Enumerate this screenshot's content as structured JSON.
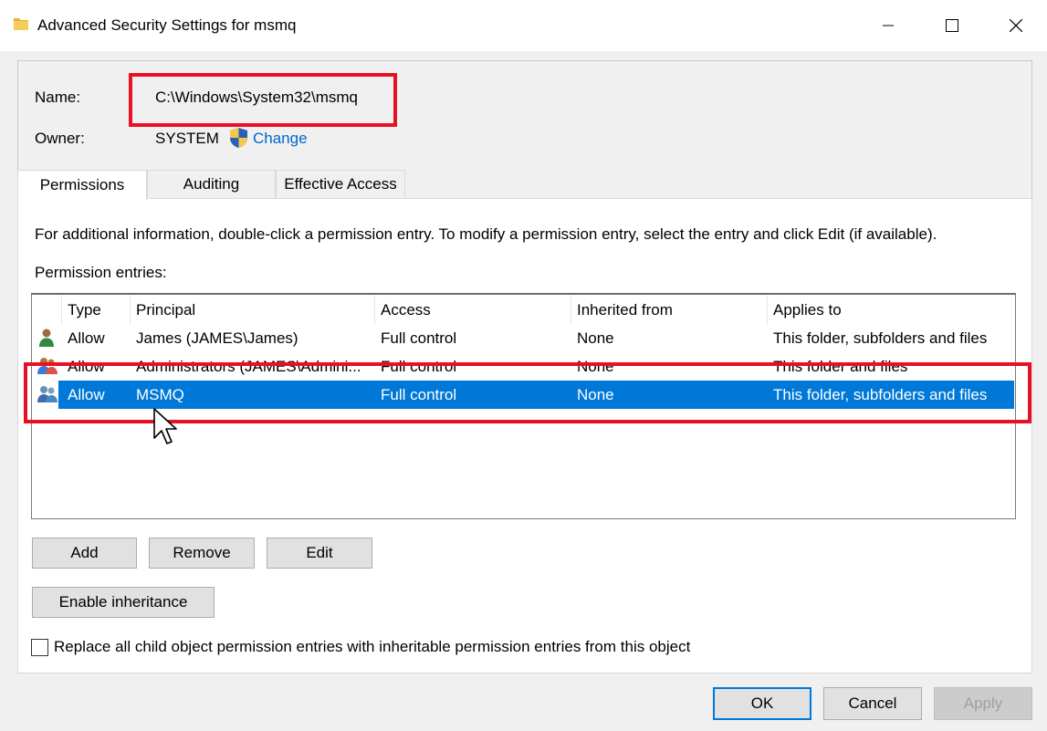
{
  "window": {
    "title": "Advanced Security Settings for msmq",
    "icon": "folder-icon",
    "controls": [
      "minimize-icon",
      "maximize-icon",
      "close-icon"
    ]
  },
  "name_label": "Name:",
  "name_value": "C:\\Windows\\System32\\msmq",
  "owner_label": "Owner:",
  "owner_value": "SYSTEM",
  "owner_change_link": "Change",
  "tabs": [
    {
      "label": "Permissions",
      "active": true
    },
    {
      "label": "Auditing",
      "active": false
    },
    {
      "label": "Effective Access",
      "active": false
    }
  ],
  "info_text": "For additional information, double-click a permission entry. To modify a permission entry, select the entry and click Edit (if available).",
  "entries_label": "Permission entries:",
  "columns": [
    "Type",
    "Principal",
    "Access",
    "Inherited from",
    "Applies to"
  ],
  "rows": [
    {
      "icon": "user-icon",
      "type": "Allow",
      "principal": "James (JAMES\\James)",
      "access": "Full control",
      "inherited": "None",
      "applies": "This folder, subfolders and files",
      "selected": false
    },
    {
      "icon": "group-icon",
      "type": "Allow",
      "principal": "Administrators (JAMES\\Admini...",
      "access": "Full control",
      "inherited": "None",
      "applies": "This folder and files",
      "selected": false
    },
    {
      "icon": "group-icon",
      "type": "Allow",
      "principal": "MSMQ",
      "access": "Full control",
      "inherited": "None",
      "applies": "This folder, subfolders and files",
      "selected": true
    }
  ],
  "buttons": {
    "add": "Add",
    "remove": "Remove",
    "edit": "Edit",
    "enable_inheritance": "Enable inheritance",
    "ok": "OK",
    "cancel": "Cancel",
    "apply": "Apply"
  },
  "replace_checkbox_label": "Replace all child object permission entries with inheritable permission entries from this object",
  "colors": {
    "accent": "#0078d7",
    "highlight_box": "#e81123",
    "link": "#0066cc"
  }
}
